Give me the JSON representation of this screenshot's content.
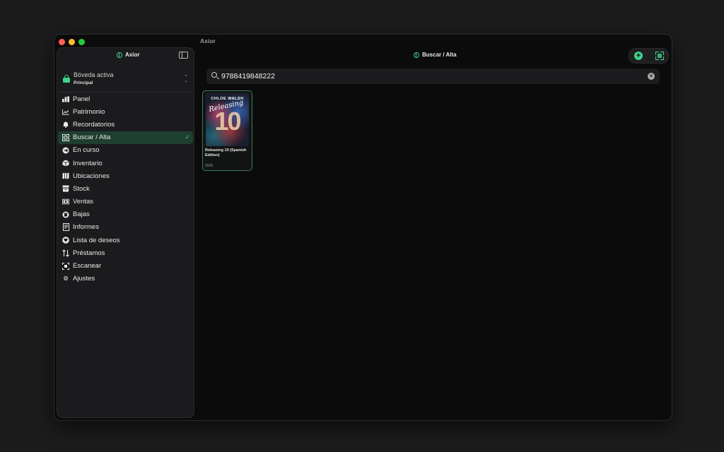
{
  "window": {
    "title": "Axior"
  },
  "sidebar": {
    "app_name": "Axior",
    "vault": {
      "title": "Bóveda activa",
      "subtitle": "Principal"
    },
    "items": [
      {
        "label": "Panel",
        "icon": "bar-chart-icon"
      },
      {
        "label": "Patrimonio",
        "icon": "line-chart-icon"
      },
      {
        "label": "Recordatorios",
        "icon": "bell-icon"
      },
      {
        "label": "Buscar / Alta",
        "icon": "grid-icon",
        "active": true
      },
      {
        "label": "En curso",
        "icon": "arrow-circle-icon"
      },
      {
        "label": "Inventario",
        "icon": "box-icon"
      },
      {
        "label": "Ubicaciones",
        "icon": "map-icon"
      },
      {
        "label": "Stock",
        "icon": "archive-icon"
      },
      {
        "label": "Ventas",
        "icon": "banknote-icon"
      },
      {
        "label": "Bajas",
        "icon": "trash-icon"
      },
      {
        "label": "Informes",
        "icon": "document-icon"
      },
      {
        "label": "Lista de deseos",
        "icon": "heart-icon"
      },
      {
        "label": "Préstamos",
        "icon": "swap-icon"
      },
      {
        "label": "Escanear",
        "icon": "scan-icon"
      },
      {
        "label": "Ajustes",
        "icon": "gear-icon"
      }
    ]
  },
  "main": {
    "title": "Buscar / Alta",
    "search": {
      "value": "9788419848222",
      "placeholder": ""
    },
    "results": [
      {
        "title": "Releasing 10 (Spanish Edition)",
        "year": "2026",
        "cover_author": "CHLOE WALSH",
        "cover_script": "Releasing",
        "cover_number": "10"
      }
    ]
  },
  "colors": {
    "accent": "#3fd38b",
    "active_bg": "#1f3f30",
    "background": "#0b0b0c"
  }
}
